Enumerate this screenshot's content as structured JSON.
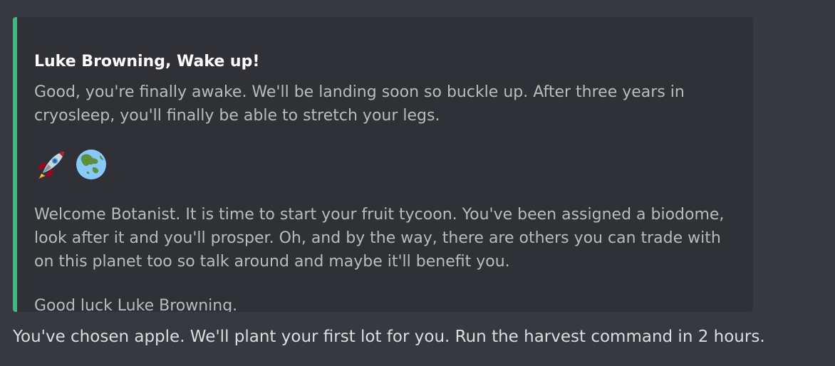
{
  "embed": {
    "title": "Luke Browning, Wake up!",
    "intro": "Good, you're finally awake. We'll be landing soon so buckle up. After three years in cryosleep, you'll finally be able to stretch your legs.",
    "emojis": [
      "rocket-icon",
      "earth-globe-asia-icon"
    ],
    "welcome": "Welcome Botanist. It is time to start your fruit tycoon. You've been assigned a biodome, look after it and you'll prosper. Oh, and by the way, there are others you can trade with on this planet too so talk around and maybe it'll benefit you.",
    "closing": "Good luck Luke Browning.",
    "accent_color": "#43b581"
  },
  "message": {
    "text": "You've chosen apple. We'll plant your first lot for you. Run the harvest command in 2 hours."
  },
  "colors": {
    "background": "#36393f",
    "embed_background": "#2f3136",
    "title_text": "#ffffff",
    "body_text": "#b9bbbe",
    "message_text": "#dcddde"
  }
}
